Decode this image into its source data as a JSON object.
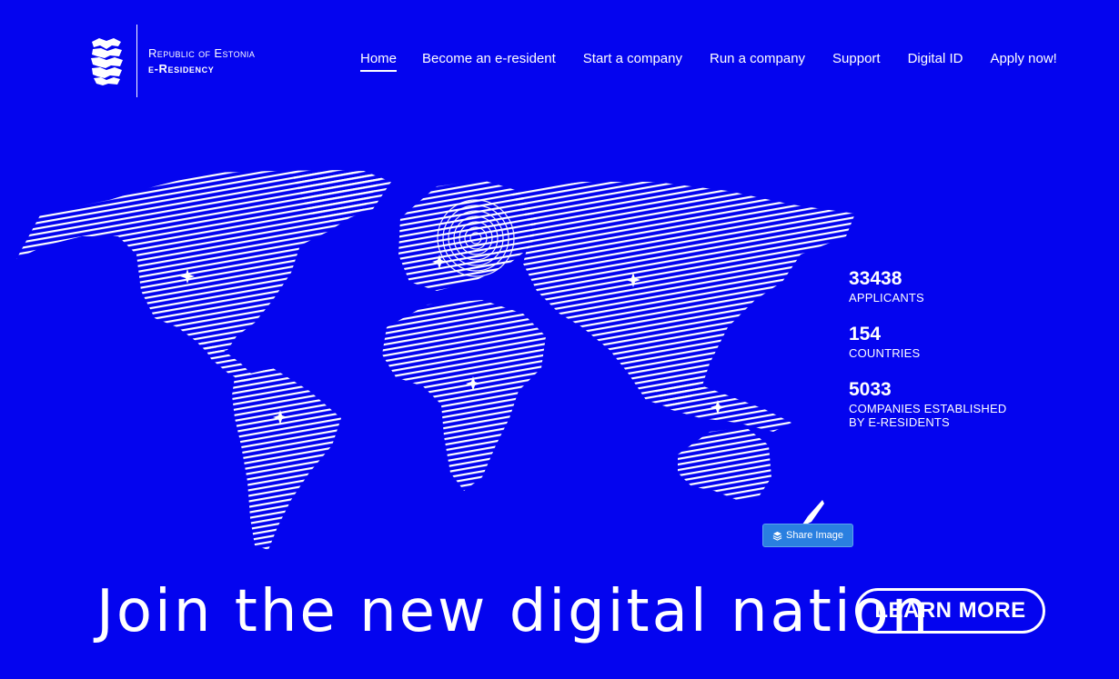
{
  "logo": {
    "line1": "Republic of Estonia",
    "line2": "e-Residency",
    "icon": "three-lions-emblem-icon"
  },
  "nav": {
    "items": [
      {
        "label": "Home",
        "active": true
      },
      {
        "label": "Become an e-resident",
        "active": false
      },
      {
        "label": "Start a company",
        "active": false
      },
      {
        "label": "Run a company",
        "active": false
      },
      {
        "label": "Support",
        "active": false
      },
      {
        "label": "Digital ID",
        "active": false
      },
      {
        "label": "Apply now!",
        "active": false
      }
    ]
  },
  "stats": [
    {
      "value": "33438",
      "label": "APPLICANTS"
    },
    {
      "value": "154",
      "label": "COUNTRIES"
    },
    {
      "value": "5033",
      "label": "COMPANIES ESTABLISHED BY E-RESIDENTS"
    }
  ],
  "share": {
    "label": "Share Image",
    "icon": "layers-icon"
  },
  "headline": "Join the new digital nation",
  "cta": {
    "label": "LEARN MORE"
  },
  "colors": {
    "background": "#0404ef",
    "foreground": "#ffffff",
    "share_button": "#2a7fe0"
  }
}
